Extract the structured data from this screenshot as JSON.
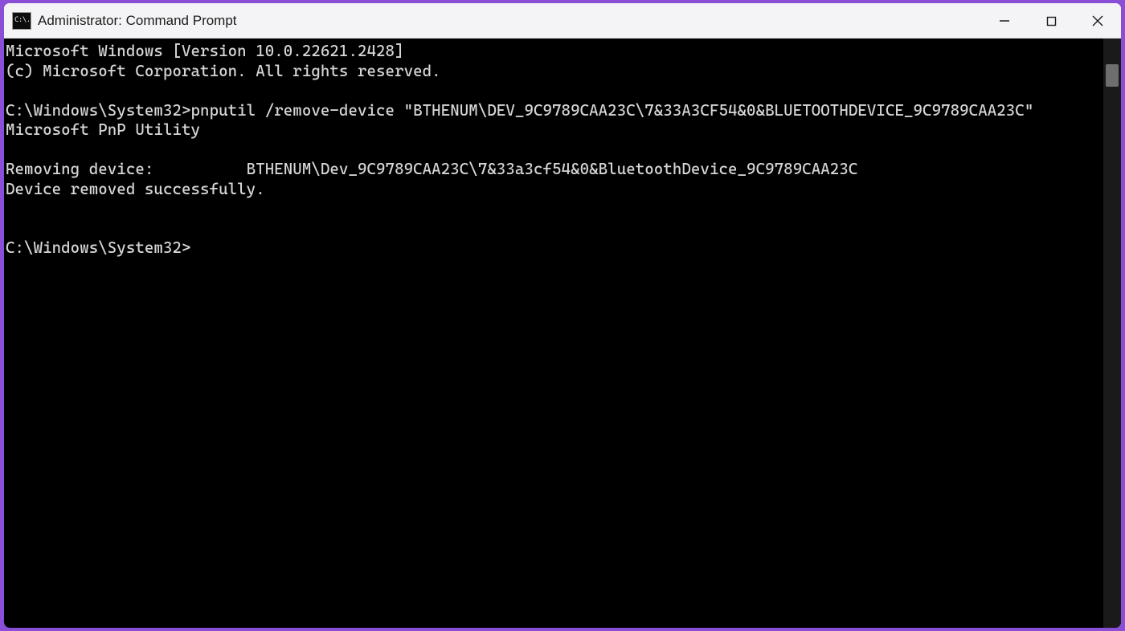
{
  "window": {
    "title": "Administrator: Command Prompt",
    "icon_glyph": "C:\\."
  },
  "controls": {
    "minimize_aria": "Minimize",
    "maximize_aria": "Maximize",
    "close_aria": "Close"
  },
  "terminal": {
    "lines": {
      "l0": "Microsoft Windows [Version 10.0.22621.2428]",
      "l1": "(c) Microsoft Corporation. All rights reserved.",
      "l2": "",
      "l3": "C:\\Windows\\System32>pnputil /remove-device \"BTHENUM\\DEV_9C9789CAA23C\\7&33A3CF54&0&BLUETOOTHDEVICE_9C9789CAA23C\"",
      "l4": "Microsoft PnP Utility",
      "l5": "",
      "l6": "Removing device:          BTHENUM\\Dev_9C9789CAA23C\\7&33a3cf54&0&BluetoothDevice_9C9789CAA23C",
      "l7": "Device removed successfully.",
      "l8": "",
      "l9": "",
      "l10": "C:\\Windows\\System32>"
    }
  }
}
